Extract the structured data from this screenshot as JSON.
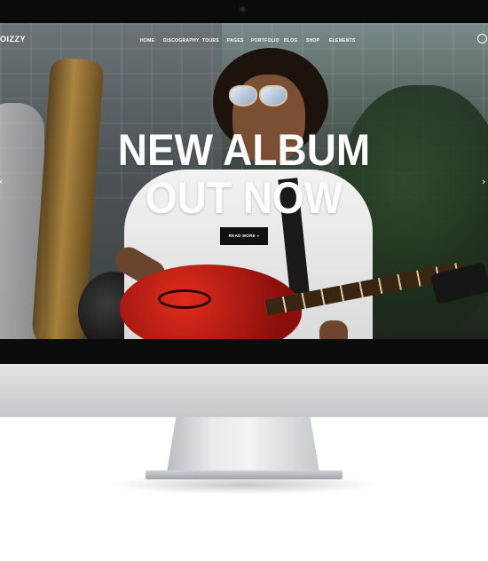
{
  "site": {
    "logo": "OIZZY"
  },
  "nav": {
    "items": [
      "HOME",
      "DISCOGRAPHY",
      "TOURS",
      "PAGES",
      "PORTFOLIO",
      "BLOG",
      "SHOP",
      "ELEMENTS"
    ]
  },
  "hero": {
    "title_line1": "NEW ALBUM",
    "title_line2": "OUT NOW",
    "cta_label": "READ MORE »"
  },
  "slider": {
    "prev_icon": "chevron-left-icon",
    "next_icon": "chevron-right-icon"
  },
  "colors": {
    "cta_bg": "#111111",
    "text": "#ffffff",
    "guitar": "#c21f14"
  }
}
